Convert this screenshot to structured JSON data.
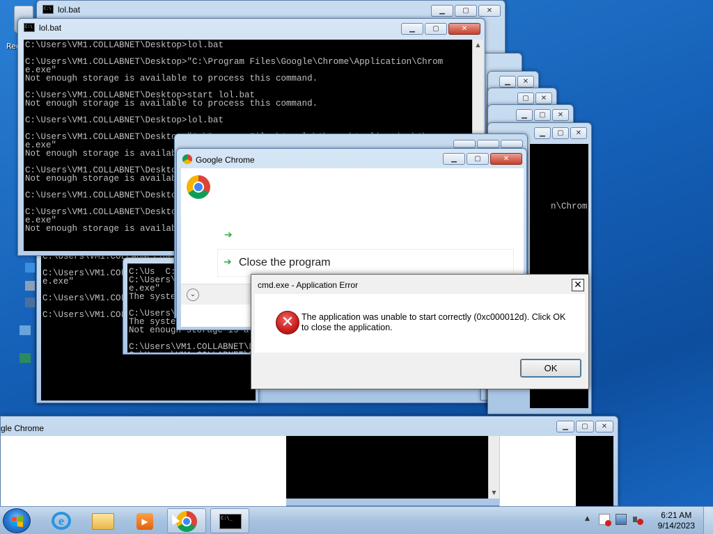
{
  "desktop": {
    "recycle_label": "Rec"
  },
  "windows": {
    "back_cmd_title": "lol.bat",
    "front_cmd_title": "lol.bat",
    "front_cmd_text": "C:\\Users\\VM1.COLLABNET\\Desktop>lol.bat\n\nC:\\Users\\VM1.COLLABNET\\Desktop>\"C:\\Program Files\\Google\\Chrome\\Application\\Chrom\ne.exe\"\nNot enough storage is available to process this command.\n\nC:\\Users\\VM1.COLLABNET\\Desktop>start lol.bat\nNot enough storage is available to process this command.\n\nC:\\Users\\VM1.COLLABNET\\Desktop>lol.bat\n\nC:\\Users\\VM1.COLLABNET\\Desktop>\"C:\\Program Files\\Google\\Chrome\\Application\\Chrom\ne.exe\"\nNot enough storage is available to process this command.\n\nC:\\Users\\VM1.COLLABNET\\Desktop>start lol.bat\nNot enough storage is available to process this command.\n\nC:\\Users\\VM1.COLLABNET\\Desktop>lol.bat\n\nC:\\Users\\VM1.COLLABNET\\Desktop>\"C:\\Program Files\\Google\\Chrome\\Application\\Chrom\ne.exe\"\nNot enough storage is available to process this command.",
    "mid_cmd_text": "C:\\Us  C:  No  e.\nC:\\Users\\VM1.COLLABNET\\Desktop>\"C:\\Program Files\\Google\\Chrome\\Application\\Chrom\ne.exe\"\nThe system cannot find the file specified.\n\nC:\\Users\\VM1.COLLABNET\\Desktop>start lol.bat\nThe system cannot find the file specified.\nNot enough storage is available to process this command.\n\nC:\\Users\\VM1.COLLABNET\\Desktop>lol.bat\nC:\\Users\\VM1.COLLABNET\\Desktop>lol.bat",
    "lower_cmd_text": "C:\\Users\\VM1.COLLABNET\\Desktop>lol.bat\n\nC:\\Users\\VM1.COLLABNET\\Desktop>\"C:\\Program Files\\Google\\Chrome\\Application\\Chrom\ne.exe\"\n\nC:\\Users\\VM1.COLLABNET\\Desktop>start lol.bat\n\nC:\\Users\\VM1.COLLABNET\\Desktop>lol.bat",
    "right_cmd_fragment": "n\\Chrom",
    "right_cmd_fragment2": "Chrom",
    "chrome_dialog_title": "Google Chrome",
    "chrome_close_option": "Close the program",
    "bottom_chrome_title": "gle Chrome"
  },
  "error_dialog": {
    "title": "cmd.exe - Application Error",
    "message": "The application was unable to start correctly (0xc000012d). Click OK to close the application.",
    "ok_label": "OK",
    "close_glyph": "✕"
  },
  "window_buttons": {
    "minimize": "▁",
    "maximize": "▢",
    "close": "✕"
  },
  "taskbar": {
    "time": "6:21 AM",
    "date": "9/14/2023",
    "tray_arrow": "▲"
  }
}
